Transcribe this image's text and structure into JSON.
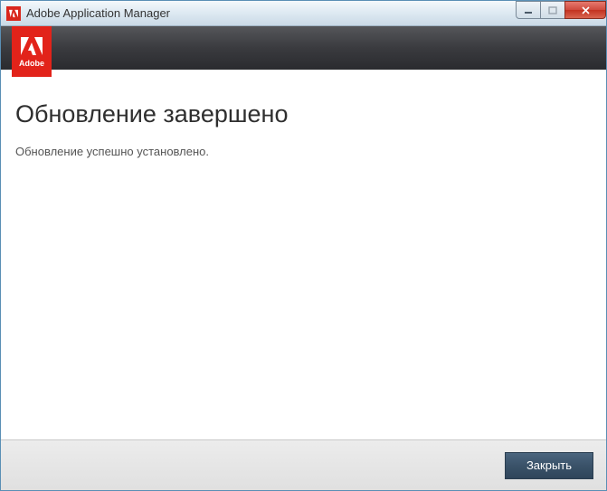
{
  "window": {
    "title": "Adobe Application Manager"
  },
  "logo": {
    "brand": "Adobe"
  },
  "content": {
    "heading": "Обновление завершено",
    "message": "Обновление успешно установлено."
  },
  "footer": {
    "close_label": "Закрыть"
  }
}
